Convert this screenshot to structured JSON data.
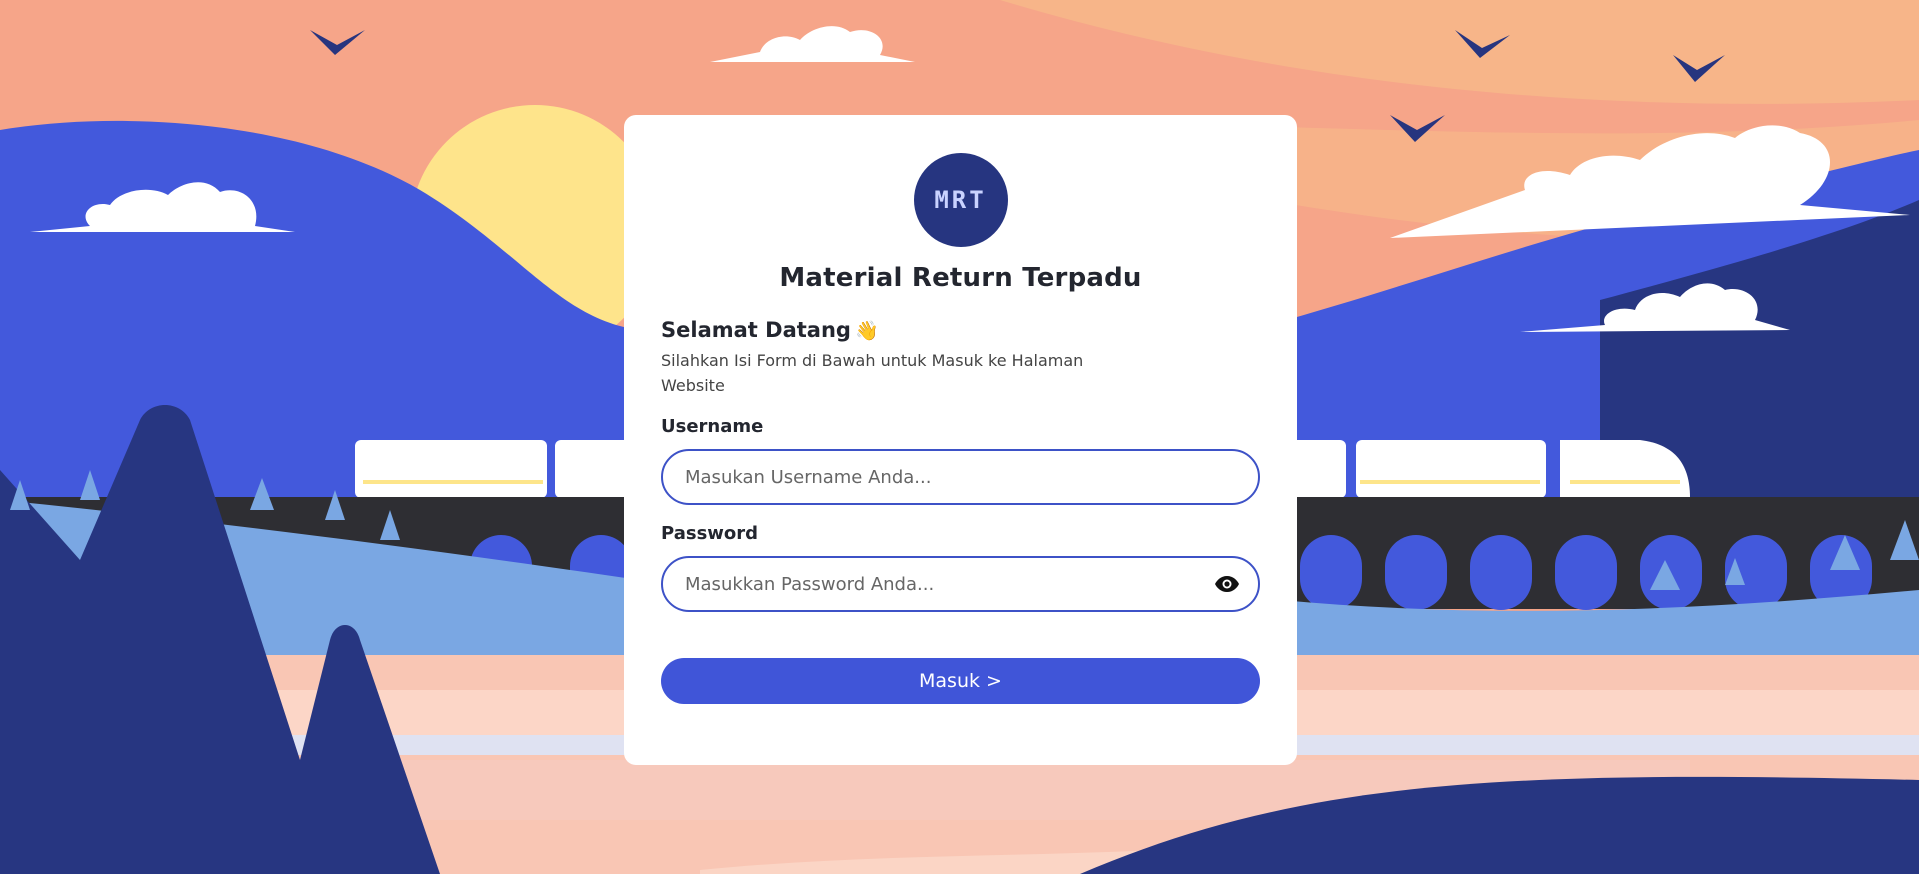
{
  "app": {
    "logo_text": "MRT",
    "title": "Material Return Terpadu"
  },
  "welcome": {
    "heading": "Selamat Datang",
    "wave": "👋",
    "subtitle": "Silahkan Isi Form di Bawah untuk Masuk ke Halaman Website"
  },
  "form": {
    "username_label": "Username",
    "username_placeholder": "Masukan Username Anda...",
    "password_label": "Password",
    "password_placeholder": "Masukkan Password Anda...",
    "submit_label": "Masuk >"
  },
  "icons": {
    "password_toggle": "eye-icon"
  },
  "colors": {
    "primary": "#4055d8",
    "logo_bg": "#263580",
    "field_border": "#3d52c7",
    "sky": "#f6a589"
  }
}
